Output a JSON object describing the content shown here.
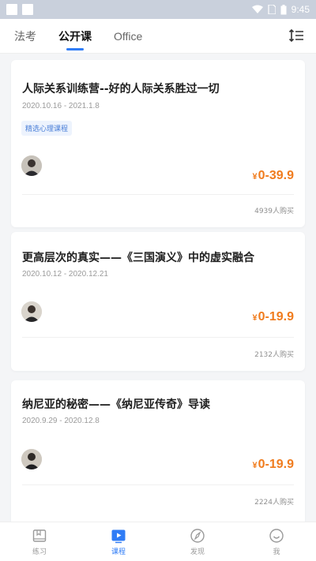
{
  "status_bar": {
    "time": "9:45"
  },
  "top_tabs": [
    {
      "label": "法考",
      "active": false
    },
    {
      "label": "公开课",
      "active": true
    },
    {
      "label": "Office",
      "active": false
    }
  ],
  "courses": [
    {
      "title": "人际关系训练营--好的人际关系胜过一切",
      "date": "2020.10.16 - 2021.1.8",
      "tag": "精选心理课程",
      "price_symbol": "¥",
      "price": "0-39.9",
      "buyers": "4939人购买"
    },
    {
      "title": "更高层次的真实——《三国演义》中的虚实融合",
      "date": "2020.10.12 - 2020.12.21",
      "tag": "",
      "price_symbol": "¥",
      "price": "0-19.9",
      "buyers": "2132人购买"
    },
    {
      "title": "纳尼亚的秘密——《纳尼亚传奇》导读",
      "date": "2020.9.29 - 2020.12.8",
      "tag": "",
      "price_symbol": "¥",
      "price": "0-19.9",
      "buyers": "2224人购买"
    }
  ],
  "bottom_nav": [
    {
      "label": "练习",
      "icon": "practice-icon",
      "active": false
    },
    {
      "label": "课程",
      "icon": "course-play-icon",
      "active": true
    },
    {
      "label": "发现",
      "icon": "compass-icon",
      "active": false
    },
    {
      "label": "我",
      "icon": "smile-icon",
      "active": false
    }
  ],
  "colors": {
    "accent": "#2f7cf6",
    "price": "#f07c1e",
    "status_bar": "#c9d0dc"
  }
}
